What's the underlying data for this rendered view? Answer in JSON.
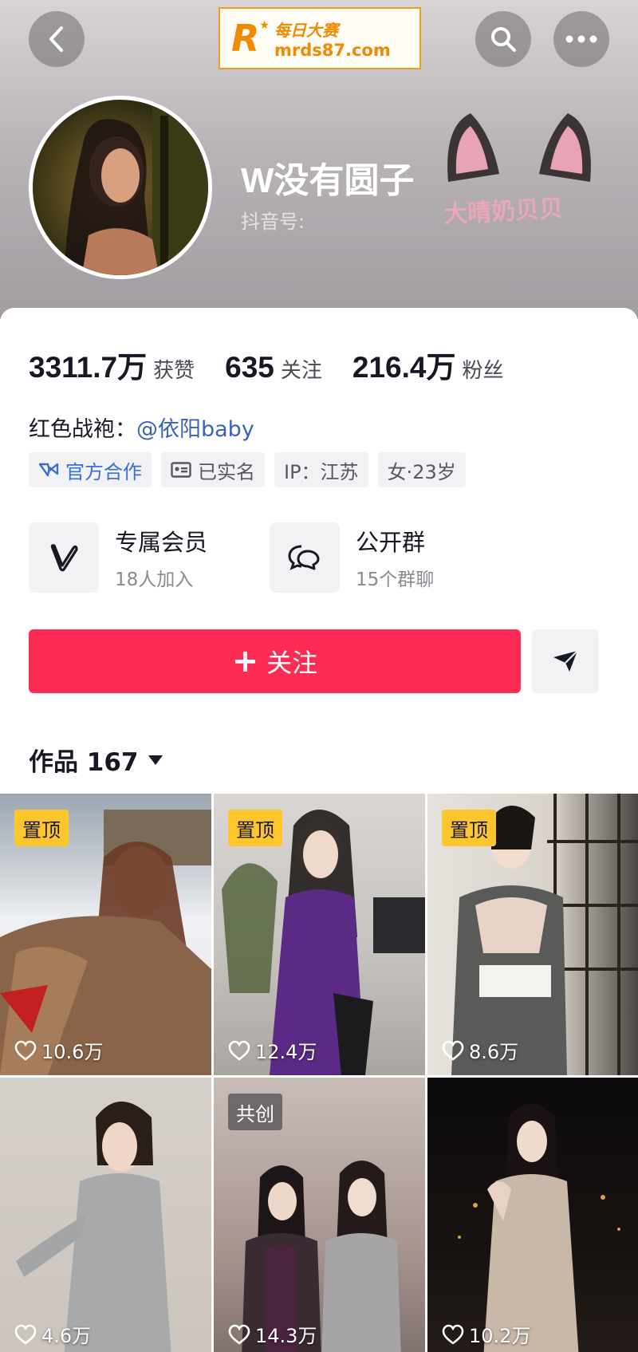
{
  "header": {
    "watermark": {
      "cn": "每日大赛",
      "url": "mrds87.com",
      "logo_letter": "R"
    },
    "nickname": "W没有圆子",
    "douyin_id_label": "抖音号:",
    "deco_text": "大晴奶贝贝"
  },
  "stats": [
    {
      "value": "3311.7万",
      "label": "获赞"
    },
    {
      "value": "635",
      "label": "关注"
    },
    {
      "value": "216.4万",
      "label": "粉丝"
    }
  ],
  "bio": {
    "prefix": "红色战袍：",
    "mention": "@依阳baby"
  },
  "tags": [
    {
      "label": "官方合作",
      "icon": "official-icon"
    },
    {
      "label": "已实名",
      "icon": "id-card-icon"
    },
    {
      "label": "IP：江苏"
    },
    {
      "label": "女·23岁"
    }
  ],
  "features": [
    {
      "title": "专属会员",
      "sub": "18人加入",
      "icon": "vip-v-icon"
    },
    {
      "title": "公开群",
      "sub": "15个群聊",
      "icon": "group-chat-icon"
    }
  ],
  "actions": {
    "follow_label": "关注"
  },
  "works_tab": {
    "label": "作品 167"
  },
  "videos": [
    {
      "badge": "置顶",
      "likes": "10.6万"
    },
    {
      "badge": "置顶",
      "likes": "12.4万"
    },
    {
      "badge": "置顶",
      "likes": "8.6万"
    },
    {
      "badge": "",
      "likes": "4.6万"
    },
    {
      "badge": "共创",
      "likes": "14.3万"
    },
    {
      "badge": "",
      "likes": "10.2万"
    }
  ],
  "colors": {
    "accent": "#fe2c55",
    "pin_badge": "#fdc62c",
    "mention": "#3a63b8"
  }
}
